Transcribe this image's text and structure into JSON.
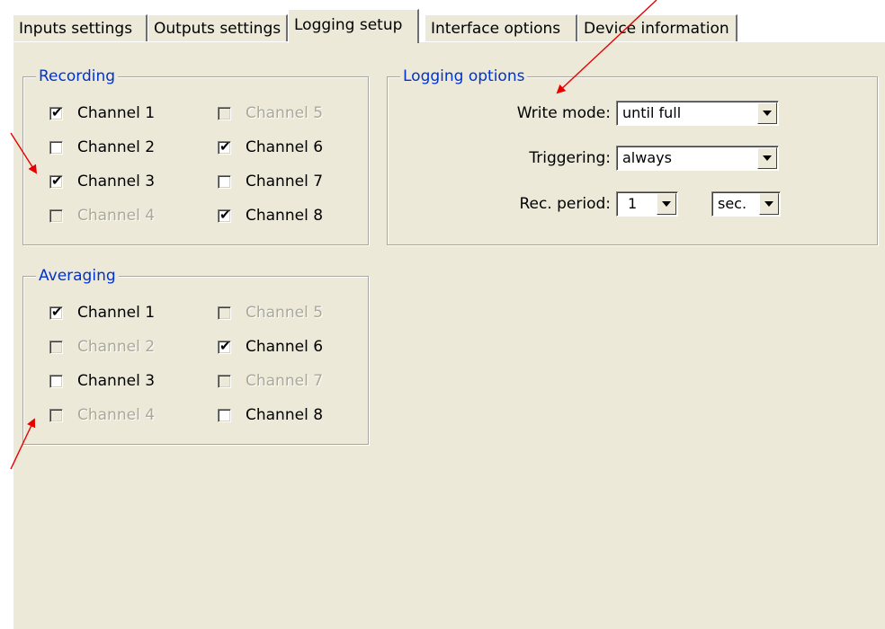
{
  "tabs": [
    {
      "label": "Inputs settings"
    },
    {
      "label": "Outputs settings"
    },
    {
      "label": "Logging setup"
    },
    {
      "label": "Interface options"
    },
    {
      "label": "Device information"
    }
  ],
  "recording": {
    "title": "Recording",
    "channels": [
      {
        "label": "Channel 1",
        "checked": true,
        "enabled": true
      },
      {
        "label": "Channel 2",
        "checked": false,
        "enabled": true
      },
      {
        "label": "Channel 3",
        "checked": true,
        "enabled": true
      },
      {
        "label": "Channel 4",
        "checked": false,
        "enabled": false
      },
      {
        "label": "Channel 5",
        "checked": false,
        "enabled": false
      },
      {
        "label": "Channel 6",
        "checked": true,
        "enabled": true
      },
      {
        "label": "Channel 7",
        "checked": false,
        "enabled": true
      },
      {
        "label": "Channel 8",
        "checked": true,
        "enabled": true
      }
    ]
  },
  "averaging": {
    "title": "Averaging",
    "channels": [
      {
        "label": "Channel 1",
        "checked": true,
        "enabled": true
      },
      {
        "label": "Channel 2",
        "checked": false,
        "enabled": false
      },
      {
        "label": "Channel 3",
        "checked": false,
        "enabled": true
      },
      {
        "label": "Channel 4",
        "checked": false,
        "enabled": false
      },
      {
        "label": "Channel 5",
        "checked": false,
        "enabled": false
      },
      {
        "label": "Channel 6",
        "checked": true,
        "enabled": true
      },
      {
        "label": "Channel 7",
        "checked": false,
        "enabled": false
      },
      {
        "label": "Channel 8",
        "checked": false,
        "enabled": true
      }
    ]
  },
  "logging_options": {
    "title": "Logging options",
    "write_mode": {
      "label": "Write mode:",
      "value": "until full"
    },
    "triggering": {
      "label": "Triggering:",
      "value": "always"
    },
    "rec_period": {
      "label": "Rec. period:",
      "value": "1",
      "unit": "sec."
    }
  },
  "colors": {
    "panel": "#ece9d8",
    "group_title": "#0033cc",
    "annotation": "#e60000"
  }
}
